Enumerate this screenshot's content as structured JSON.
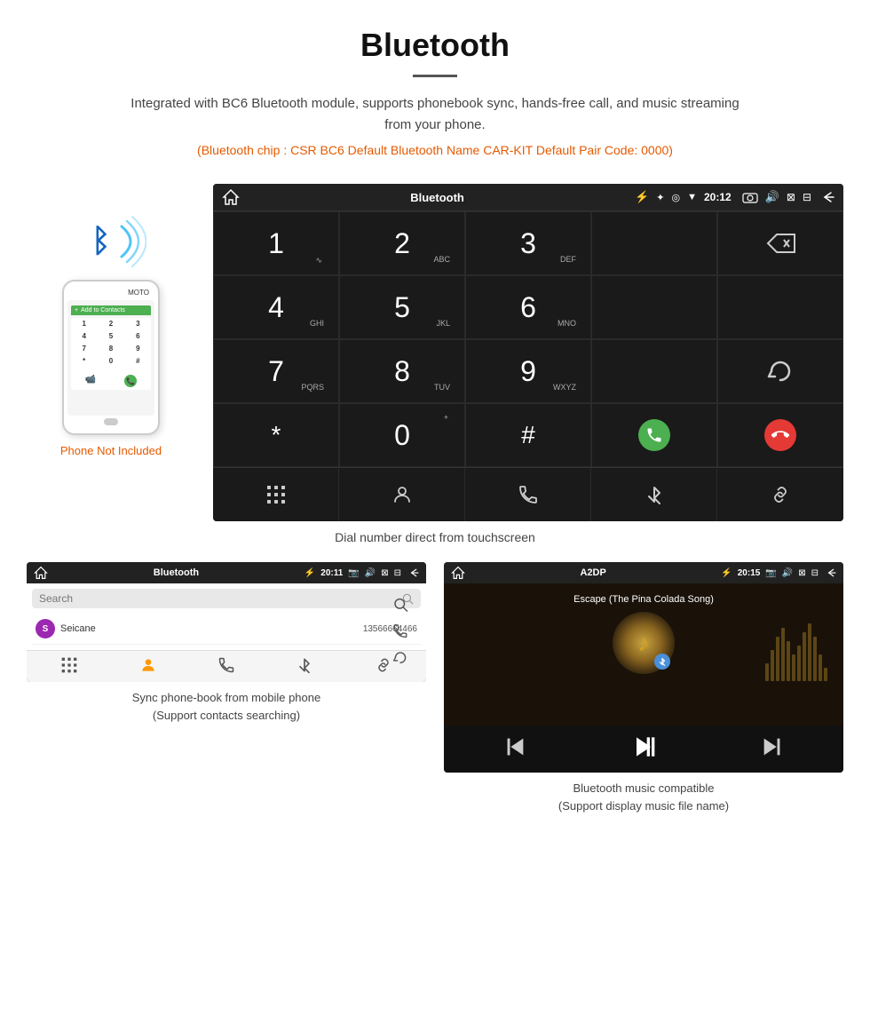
{
  "header": {
    "title": "Bluetooth",
    "description": "Integrated with BC6 Bluetooth module, supports phonebook sync, hands-free call, and music streaming from your phone.",
    "specs": "(Bluetooth chip : CSR BC6    Default Bluetooth Name CAR-KIT    Default Pair Code: 0000)"
  },
  "phone_note": "Phone Not Included",
  "car_screen": {
    "status_bar": {
      "title": "Bluetooth",
      "usb_icon": "⚡",
      "time": "20:12"
    },
    "dialpad": {
      "keys": [
        {
          "num": "1",
          "letters": "∿"
        },
        {
          "num": "2",
          "letters": "ABC"
        },
        {
          "num": "3",
          "letters": "DEF"
        },
        {
          "num": "",
          "letters": ""
        },
        {
          "num": "⌫",
          "letters": ""
        },
        {
          "num": "4",
          "letters": "GHI"
        },
        {
          "num": "5",
          "letters": "JKL"
        },
        {
          "num": "6",
          "letters": "MNO"
        },
        {
          "num": "",
          "letters": ""
        },
        {
          "num": "",
          "letters": ""
        },
        {
          "num": "7",
          "letters": "PQRS"
        },
        {
          "num": "8",
          "letters": "TUV"
        },
        {
          "num": "9",
          "letters": "WXYZ"
        },
        {
          "num": "",
          "letters": ""
        },
        {
          "num": "↻",
          "letters": ""
        },
        {
          "num": "*",
          "letters": ""
        },
        {
          "num": "0",
          "letters": "+"
        },
        {
          "num": "#",
          "letters": ""
        },
        {
          "num": "📞",
          "letters": ""
        },
        {
          "num": "📵",
          "letters": ""
        }
      ]
    },
    "toolbar": [
      "⊞",
      "👤",
      "📞",
      "✦",
      "🔗"
    ]
  },
  "dial_caption": "Dial number direct from touchscreen",
  "phonebook_screen": {
    "status": {
      "title": "Bluetooth",
      "time": "20:11"
    },
    "search_placeholder": "Search",
    "contacts": [
      {
        "initial": "S",
        "name": "Seicane",
        "number": "13566664466"
      }
    ],
    "toolbar": [
      "⊞",
      "👤",
      "📞",
      "✦",
      "🔗"
    ]
  },
  "phonebook_caption": "Sync phone-book from mobile phone\n(Support contacts searching)",
  "music_screen": {
    "status": {
      "title": "A2DP",
      "time": "20:15"
    },
    "song_title": "Escape (The Pina Colada Song)",
    "controls": [
      "⏮",
      "⏯",
      "⏭"
    ]
  },
  "music_caption": "Bluetooth music compatible\n(Support display music file name)"
}
